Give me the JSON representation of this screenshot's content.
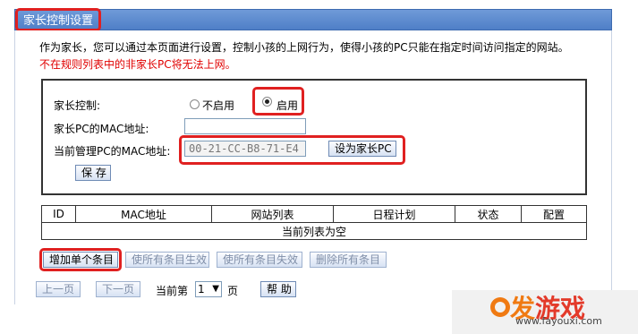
{
  "header": {
    "title": "家长控制设置"
  },
  "description": "作为家长，您可以通过本页面进行设置，控制小孩的上网行为，使得小孩的PC只能在指定时间访问指定的网站。",
  "warning": "不在规则列表中的非家长PC将无法上网。",
  "settings": {
    "parental_control_label": "家长控制:",
    "option_disable": "不启用",
    "option_enable": "启用",
    "selected": "enable",
    "parent_mac_label": "家长PC的MAC地址:",
    "parent_mac_value": "",
    "current_mac_label": "当前管理PC的MAC地址:",
    "current_mac_value": "00-21-CC-B8-71-E4",
    "set_parent_button": "设为家长PC",
    "save_button": "保 存"
  },
  "table": {
    "columns": [
      "ID",
      "MAC地址",
      "网站列表",
      "日程计划",
      "状态",
      "配置"
    ],
    "empty_text": "当前列表为空"
  },
  "actions": {
    "add": "增加单个条目",
    "enable_all": "使所有条目生效",
    "disable_all": "使所有条目失效",
    "delete_all": "删除所有条目"
  },
  "pagination": {
    "prev": "上一页",
    "next": "下一页",
    "current_label": "当前第",
    "page_value": "1",
    "page_unit": "页",
    "help": "帮 助"
  },
  "watermark": {
    "logo_part1": "发",
    "logo_part2": "游戏",
    "url": "www.fayouxi.com"
  },
  "colors": {
    "header_blue": "#5a88cc",
    "highlight_red": "#e02020",
    "warning_red": "#e00000"
  }
}
